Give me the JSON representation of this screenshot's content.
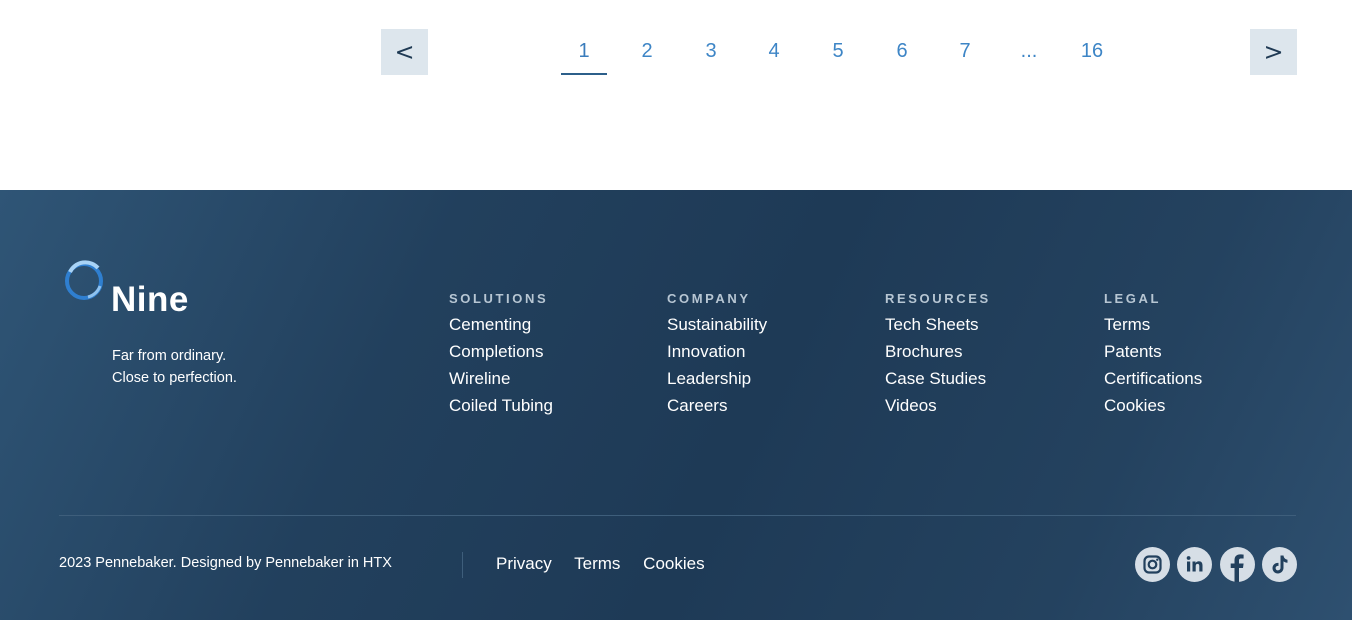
{
  "pagination": {
    "prev_label": "<",
    "next_label": ">",
    "pages": [
      "1",
      "2",
      "3",
      "4",
      "5",
      "6",
      "7",
      "...",
      "16"
    ],
    "current_page": "1"
  },
  "footer": {
    "brand": "Nine",
    "tagline_line1": "Far from ordinary.",
    "tagline_line2": "Close to perfection.",
    "columns": [
      {
        "heading": "SOLUTIONS",
        "links": [
          "Cementing",
          "Completions",
          "Wireline",
          "Coiled Tubing"
        ]
      },
      {
        "heading": "COMPANY",
        "links": [
          "Sustainability",
          "Innovation",
          "Leadership",
          "Careers"
        ]
      },
      {
        "heading": "RESOURCES",
        "links": [
          "Tech Sheets",
          "Brochures",
          "Case Studies",
          "Videos"
        ]
      },
      {
        "heading": "LEGAL",
        "links": [
          "Terms",
          "Patents",
          "Certifications",
          "Cookies"
        ]
      }
    ],
    "copyright": "2023 Pennebaker. Designed by Pennebaker in HTX",
    "bottom_links": [
      "Privacy",
      "Terms",
      "Cookies"
    ],
    "social_icons": [
      "instagram-icon",
      "linkedin-icon",
      "facebook-icon",
      "tiktok-icon"
    ]
  },
  "colors": {
    "accent_blue": "#3d85c6",
    "footer_bg": "#22405d",
    "arrow_bg": "#dde6ed"
  }
}
